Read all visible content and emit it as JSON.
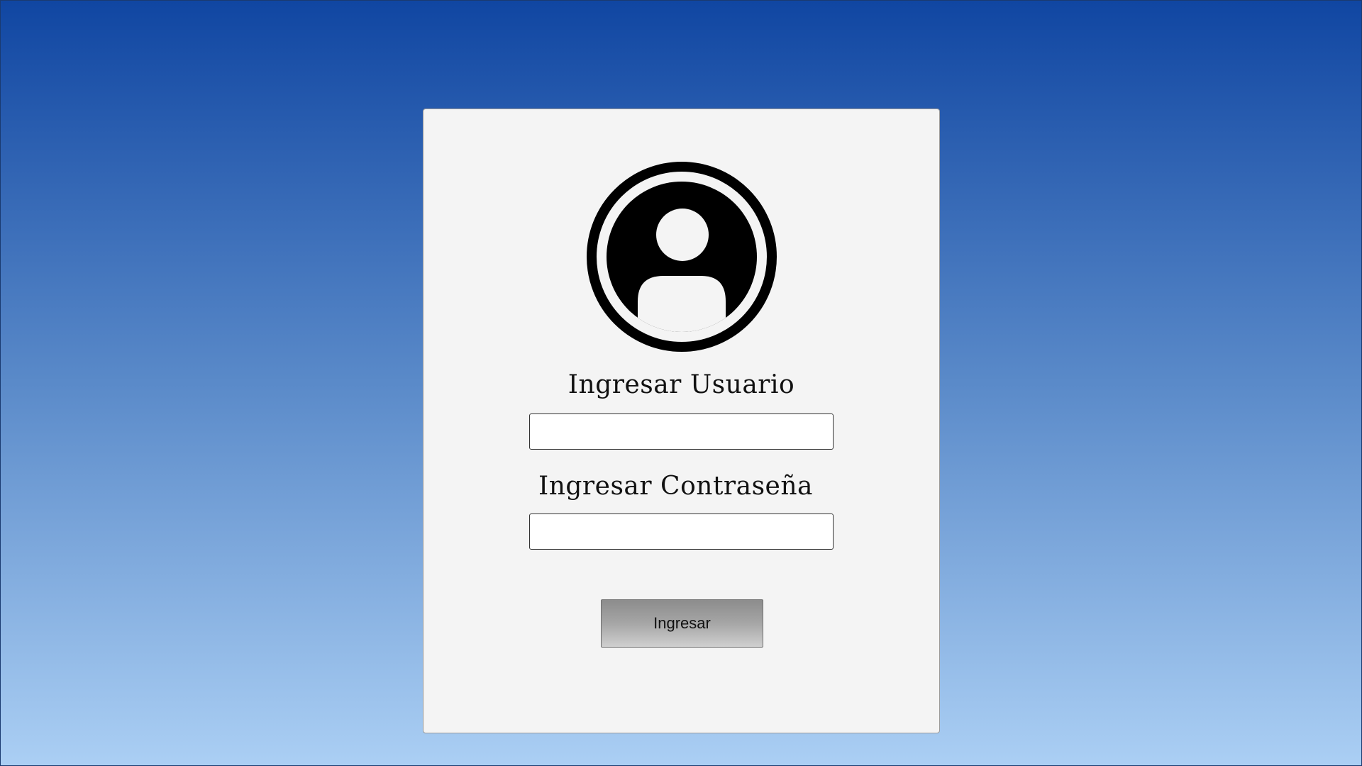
{
  "login": {
    "username_label": "Ingresar Usuario",
    "password_label": "Ingresar Contraseña",
    "username_value": "",
    "password_value": "",
    "submit_label": "Ingresar",
    "avatar_icon": "user-avatar-icon"
  },
  "colors": {
    "background_top": "#1046a2",
    "background_bottom": "#abcff4",
    "card_background": "#f4f4f4",
    "button_gradient_top": "#8c8c8c",
    "button_gradient_bottom": "#cfcfcf"
  }
}
